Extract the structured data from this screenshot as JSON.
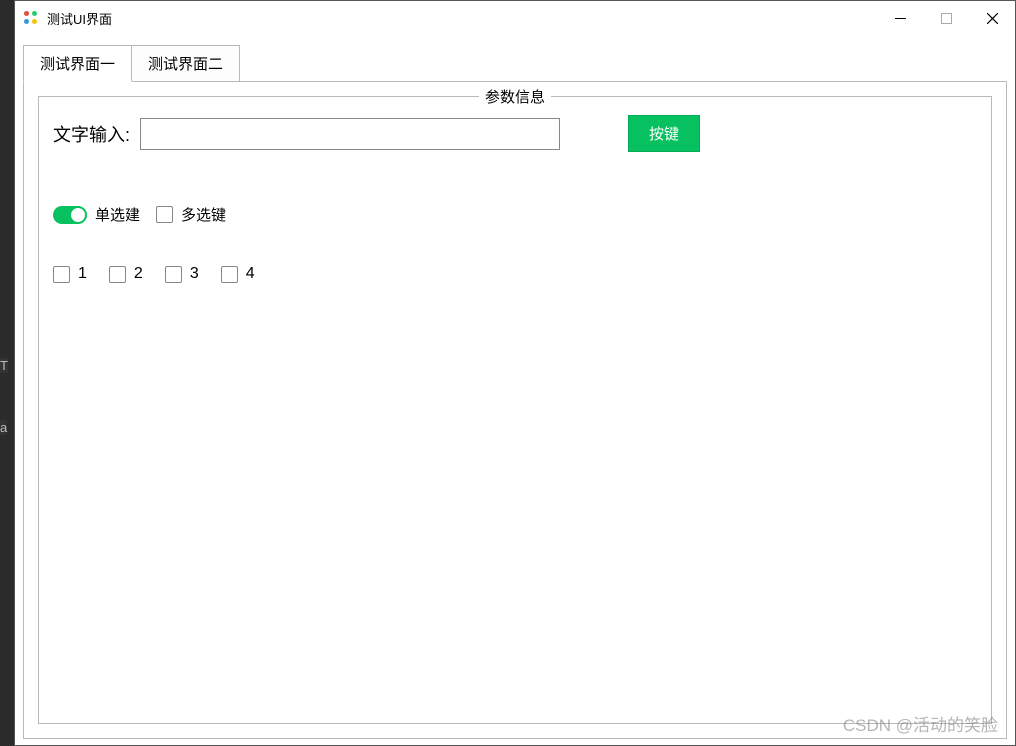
{
  "window": {
    "title": "测试UI界面"
  },
  "tabs": [
    {
      "label": "测试界面一",
      "active": true
    },
    {
      "label": "测试界面二",
      "active": false
    }
  ],
  "groupbox": {
    "title": "参数信息"
  },
  "form": {
    "text_input_label": "文字输入:",
    "text_input_value": "",
    "button_label": "按键"
  },
  "toggles": {
    "radio_switch_on": true,
    "radio_label": "单选建",
    "multi_checked": false,
    "multi_label": "多选键"
  },
  "checkboxes": [
    {
      "label": "1",
      "checked": false
    },
    {
      "label": "2",
      "checked": false
    },
    {
      "label": "3",
      "checked": false
    },
    {
      "label": "4",
      "checked": false
    }
  ],
  "bg_fragments": {
    "a": "T",
    "b": "a"
  },
  "watermark": "CSDN @活动的笑脸"
}
